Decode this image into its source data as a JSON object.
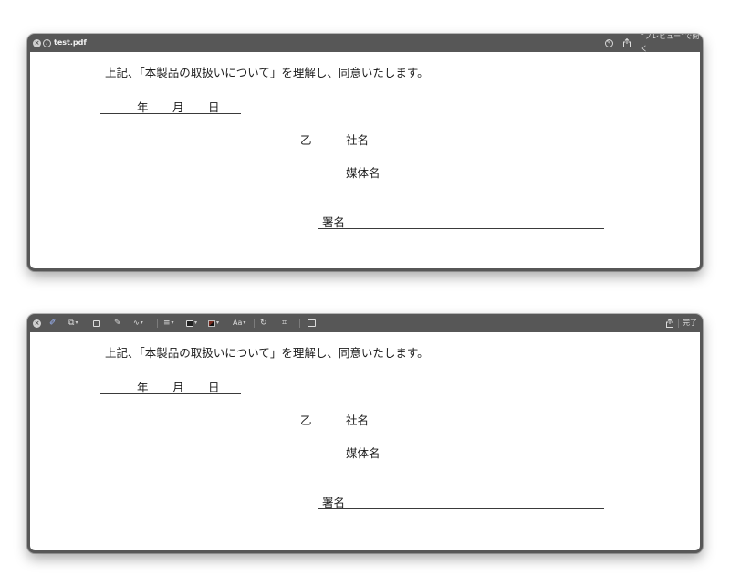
{
  "window1": {
    "filename": "test.pdf",
    "icons": [
      "close-icon",
      "edit-block-icon",
      "markup-pen-icon",
      "share-icon"
    ],
    "open_in_preview_label": "“プレビュー”で開く"
  },
  "window2": {
    "icons": [
      "close-icon",
      "markup-icon",
      "shapes-icon",
      "text-box-icon",
      "sign-icon",
      "shape-style-icon",
      "border-color-icon",
      "fill-color-icon",
      "text-style-icon",
      "rotate-icon",
      "crop-icon",
      "form-fill-icon",
      "share-icon"
    ],
    "text_style_label": "Aa",
    "done_label": "完了"
  },
  "document": {
    "statement": "上記、「本製品の取扱いについて」を理解し、同意いたします。",
    "date_year": "年",
    "date_month": "月",
    "date_day": "日",
    "party_label": "乙",
    "company_label": "社名",
    "media_label": "媒体名",
    "signature_label": "署名"
  },
  "colors": {
    "window_chrome": "#575757",
    "highlight_underline": "#e00000"
  }
}
